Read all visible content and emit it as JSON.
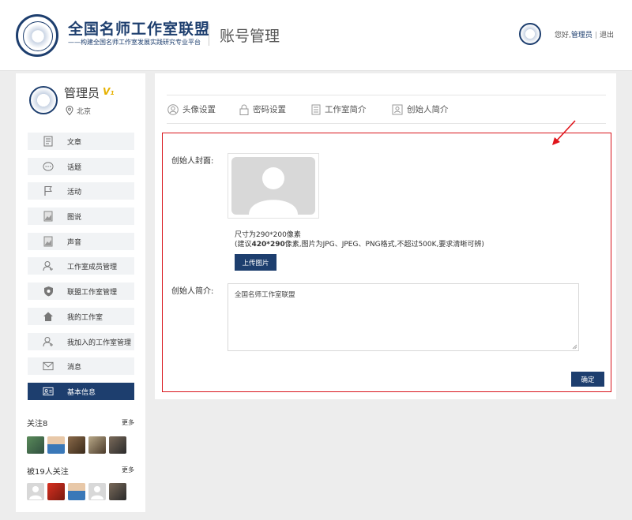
{
  "header": {
    "brand_title": "全国名师工作室联盟",
    "brand_subtitle": "——构建全国名师工作室发展实践研究专业平台",
    "page_heading": "账号管理",
    "greeting": "您好,",
    "user_link": "管理员",
    "separator": "|",
    "logout": "退出"
  },
  "profile": {
    "name": "管理员",
    "badge": "V₁",
    "location": "北京"
  },
  "sidebar": {
    "items": [
      {
        "label": "文章",
        "icon": "document-icon"
      },
      {
        "label": "话题",
        "icon": "chat-bubble-icon"
      },
      {
        "label": "活动",
        "icon": "flag-icon"
      },
      {
        "label": "图说",
        "icon": "image-icon"
      },
      {
        "label": "声音",
        "icon": "audio-file-icon"
      },
      {
        "label": "工作室成员管理",
        "icon": "member-icon"
      },
      {
        "label": "联盟工作室管理",
        "icon": "shield-icon"
      },
      {
        "label": "我的工作室",
        "icon": "home-icon"
      },
      {
        "label": "我加入的工作室管理",
        "icon": "user-plus-icon"
      },
      {
        "label": "消息",
        "icon": "mail-icon"
      },
      {
        "label": "基本信息",
        "icon": "id-card-icon",
        "active": true
      }
    ],
    "following": {
      "title": "关注8",
      "more": "更多"
    },
    "followers": {
      "title": "被19人关注",
      "more": "更多"
    }
  },
  "tabs": [
    {
      "label": "头像设置",
      "icon": "avatar-icon"
    },
    {
      "label": "密码设置",
      "icon": "lock-icon"
    },
    {
      "label": "工作室简介",
      "icon": "document-icon"
    },
    {
      "label": "创始人简介",
      "icon": "portrait-icon"
    }
  ],
  "form": {
    "cover_label": "创始人封面:",
    "size_hint": "尺寸为290*200像素",
    "suggest_prefix": "(建议",
    "suggest_size": "420*290",
    "suggest_suffix": "像素,图片为JPG、JPEG、PNG格式,不超过500K,要求清晰可辨)",
    "upload_button": "上传图片",
    "intro_label": "创始人简介:",
    "intro_value": "全国名师工作室联盟",
    "confirm_button": "确定"
  },
  "colors": {
    "brand": "#1d3e6e",
    "highlight": "#d8141b",
    "vip": "#e6b100"
  }
}
